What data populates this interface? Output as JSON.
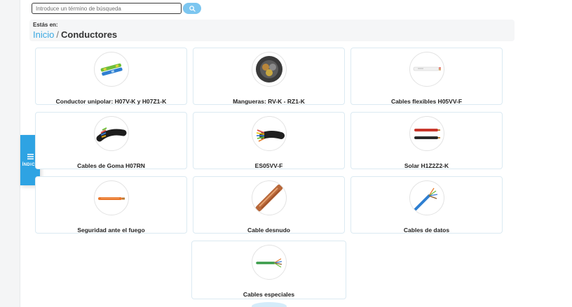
{
  "search": {
    "placeholder": "Introduce un término de búsqueda",
    "button_icon": "search-icon"
  },
  "breadcrumb": {
    "label": "Estás en:",
    "home": "Inicio",
    "separator": "/",
    "current": "Conductores"
  },
  "side_tab": {
    "label": "ÍNDICE",
    "icon": "menu-icon"
  },
  "categories": [
    {
      "label": "Conductor unipolar: H07V-K y H07Z1-K",
      "icon": "unipolar-cable-icon"
    },
    {
      "label": "Mangueras: RV-K - RZ1-K",
      "icon": "hose-cable-icon"
    },
    {
      "label": "Cables flexibles H05VV-F",
      "icon": "flexible-cable-icon"
    },
    {
      "label": "Cables de Goma H07RN",
      "icon": "rubber-cable-icon"
    },
    {
      "label": "ES05VV-F",
      "icon": "multicore-cable-icon"
    },
    {
      "label": "Solar H1Z2Z2-K",
      "icon": "solar-cable-icon"
    },
    {
      "label": "Seguridad ante el fuego",
      "icon": "fire-safety-cable-icon"
    },
    {
      "label": "Cable desnudo",
      "icon": "bare-copper-cable-icon"
    },
    {
      "label": "Cables de datos",
      "icon": "data-cable-icon"
    },
    {
      "label": "Cables especiales",
      "icon": "special-cable-icon"
    }
  ],
  "colors": {
    "accent": "#2ea3e3",
    "search_button": "#7cc6f0",
    "card_border": "#dbeaf2"
  }
}
